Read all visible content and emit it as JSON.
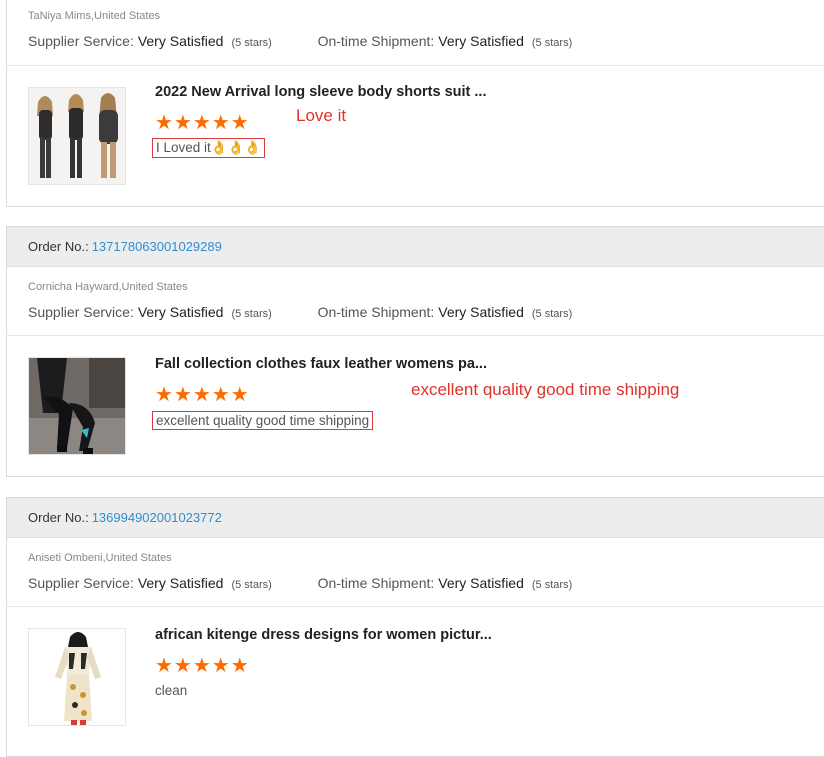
{
  "labels": {
    "order_no": "Order No.:",
    "supplier_service": "Supplier Service:",
    "ontime_shipment": "On-time Shipment:"
  },
  "colors": {
    "star": "#ff6a00",
    "link": "#2f8fcf",
    "annotation": "#e0322c"
  },
  "reviews": [
    {
      "order_number": "",
      "reviewer": "TaNiya Mims,United States",
      "supplier_value": "Very Satisfied",
      "supplier_stars": "(5 stars)",
      "shipment_value": "Very Satisfied",
      "shipment_stars": "(5 stars)",
      "product_title": "2022 New Arrival long sleeve body shorts suit ...",
      "rating": 5,
      "stars_text": "★★★★★",
      "comment": "I Loved it👌👌👌",
      "annotation": "Love it"
    },
    {
      "order_number": "137178063001029289",
      "reviewer": "Cornicha Hayward,United States",
      "supplier_value": "Very Satisfied",
      "supplier_stars": "(5 stars)",
      "shipment_value": "Very Satisfied",
      "shipment_stars": "(5 stars)",
      "product_title": "Fall collection clothes faux leather womens pa...",
      "rating": 5,
      "stars_text": "★★★★★",
      "comment": "excellent quality good time shipping",
      "annotation": "excellent quality good time shipping"
    },
    {
      "order_number": "136994902001023772",
      "reviewer": "Aniseti Ombeni,United States",
      "supplier_value": "Very Satisfied",
      "supplier_stars": "(5 stars)",
      "shipment_value": "Very Satisfied",
      "shipment_stars": "(5 stars)",
      "product_title": "african kitenge dress designs for women pictur...",
      "rating": 5,
      "stars_text": "★★★★★",
      "comment": "clean",
      "annotation": ""
    }
  ]
}
